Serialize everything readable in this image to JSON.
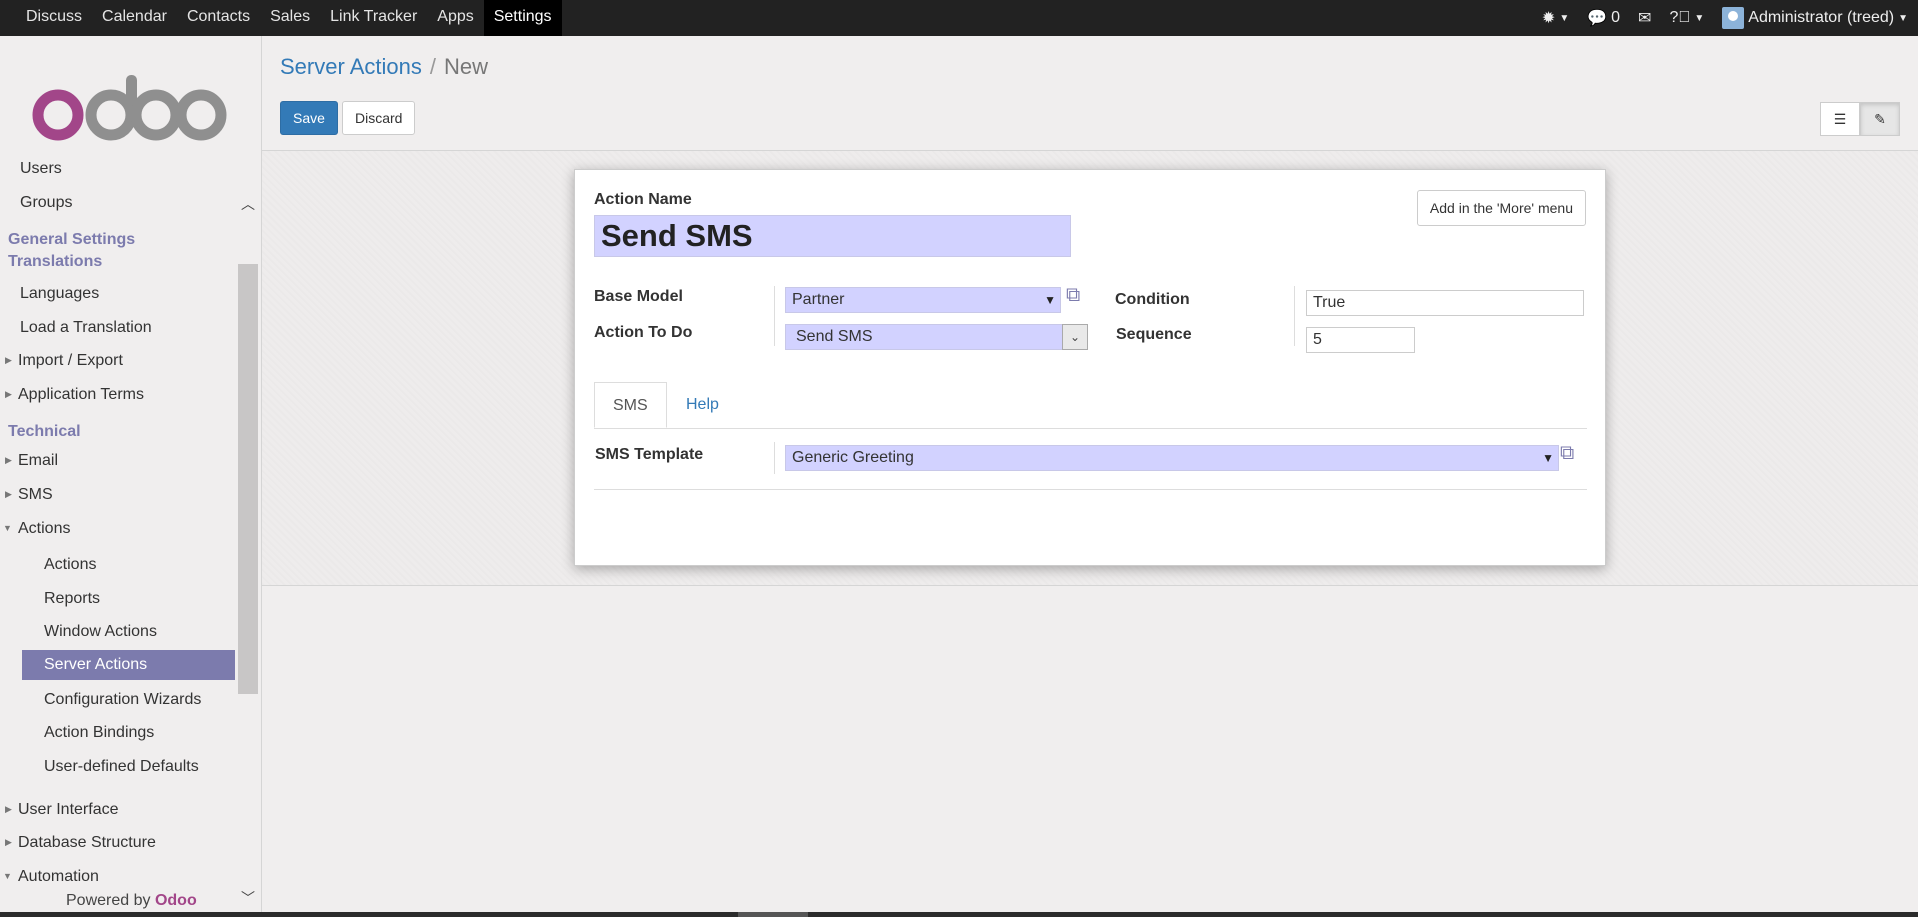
{
  "topbar": {
    "apps": [
      "Discuss",
      "Calendar",
      "Contacts",
      "Sales",
      "Link Tracker",
      "Apps",
      "Settings"
    ],
    "active_app": "Settings",
    "messages_count": "0",
    "user": "Administrator (treed)"
  },
  "sidebar": {
    "items": [
      {
        "label": "Users",
        "kind": "child"
      },
      {
        "label": "Groups",
        "kind": "child"
      },
      {
        "label": "General Settings",
        "kind": "header"
      },
      {
        "label": "Translations",
        "kind": "header"
      },
      {
        "label": "Languages",
        "kind": "child"
      },
      {
        "label": "Load a Translation",
        "kind": "child"
      },
      {
        "label": "Import / Export",
        "kind": "collapsed"
      },
      {
        "label": "Application Terms",
        "kind": "collapsed"
      },
      {
        "label": "Technical",
        "kind": "header"
      },
      {
        "label": "Email",
        "kind": "collapsed"
      },
      {
        "label": "SMS",
        "kind": "collapsed"
      },
      {
        "label": "Actions",
        "kind": "expanded"
      },
      {
        "label": "Actions",
        "kind": "sub"
      },
      {
        "label": "Reports",
        "kind": "sub"
      },
      {
        "label": "Window Actions",
        "kind": "sub"
      },
      {
        "label": "Server Actions",
        "kind": "sub-selected"
      },
      {
        "label": "Configuration Wizards",
        "kind": "sub"
      },
      {
        "label": "Action Bindings",
        "kind": "sub"
      },
      {
        "label": "User-defined Defaults",
        "kind": "sub"
      },
      {
        "label": "User Interface",
        "kind": "collapsed"
      },
      {
        "label": "Database Structure",
        "kind": "collapsed"
      },
      {
        "label": "Automation",
        "kind": "expanded"
      }
    ],
    "powered_prefix": "Powered by",
    "powered_brand": "Odoo"
  },
  "control_panel": {
    "breadcrumb_parent": "Server Actions",
    "breadcrumb_separator": "/",
    "breadcrumb_current": "New",
    "save_label": "Save",
    "discard_label": "Discard"
  },
  "form": {
    "more_menu_button": "Add in the 'More' menu",
    "action_name_label": "Action Name",
    "action_name_value": "Send SMS",
    "base_model_label": "Base Model",
    "base_model_value": "Partner",
    "action_to_do_label": "Action To Do",
    "action_to_do_value": "Send SMS",
    "condition_label": "Condition",
    "condition_value": "True",
    "sequence_label": "Sequence",
    "sequence_value": "5",
    "tabs": [
      "SMS",
      "Help"
    ],
    "active_tab": "SMS",
    "sms_template_label": "SMS Template",
    "sms_template_value": "Generic Greeting"
  },
  "icons": [
    "bug-icon",
    "chat-icon",
    "envelope-icon",
    "help-icon",
    "list-view-icon",
    "form-view-icon",
    "external-link-icon"
  ],
  "colors": {
    "brand": "#7c7bad",
    "primary": "#337ab7",
    "required_field": "#d2d2ff",
    "navbar": "#222222"
  }
}
